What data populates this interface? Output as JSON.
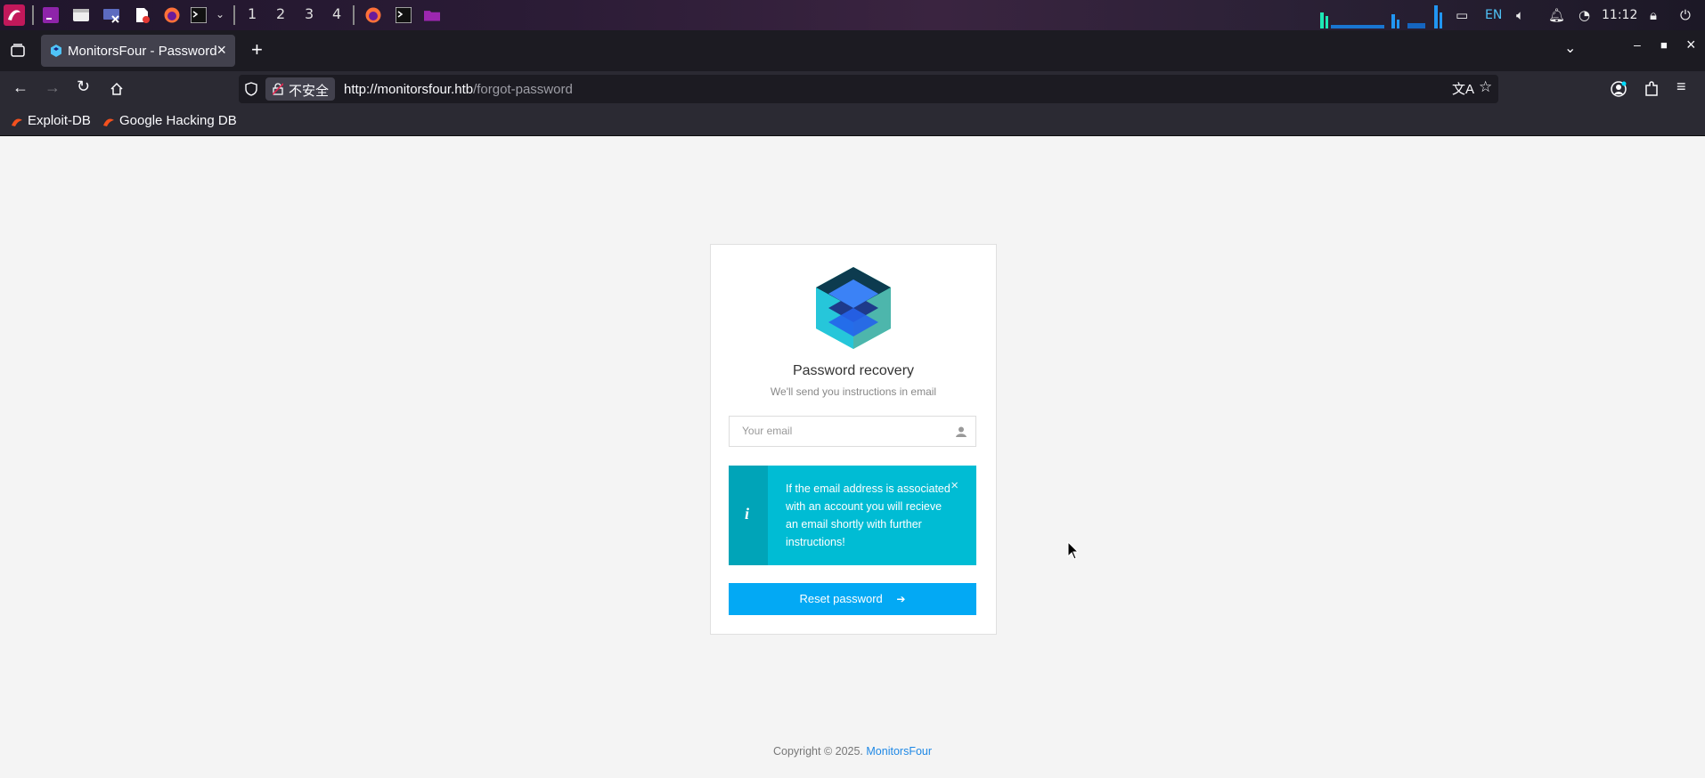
{
  "taskbar": {
    "workspaces": [
      "1",
      "2",
      "3",
      "4"
    ],
    "language": "EN",
    "clock": "11:12"
  },
  "browser": {
    "tab_title": "MonitorsFour - Password",
    "security_label": "不安全",
    "url_host": "http://monitorsfour.htb",
    "url_path": "/forgot-password",
    "bookmarks": [
      "Exploit-DB",
      "Google Hacking DB"
    ]
  },
  "page": {
    "title": "Password recovery",
    "subtitle": "We'll send you instructions in email",
    "email_placeholder": "Your email",
    "alert_message": "If the email address is associated with an account you will recieve an email shortly with further instructions!",
    "alert_close": "×",
    "alert_icon": "i",
    "submit_label": "Reset password",
    "footer_text": "Copyright © 2025.",
    "footer_link": "MonitorsFour"
  },
  "colors": {
    "primary": "#03a9f4",
    "alert_bg": "#00bcd4",
    "alert_strip": "#00a4b8",
    "link": "#1e88e5"
  }
}
